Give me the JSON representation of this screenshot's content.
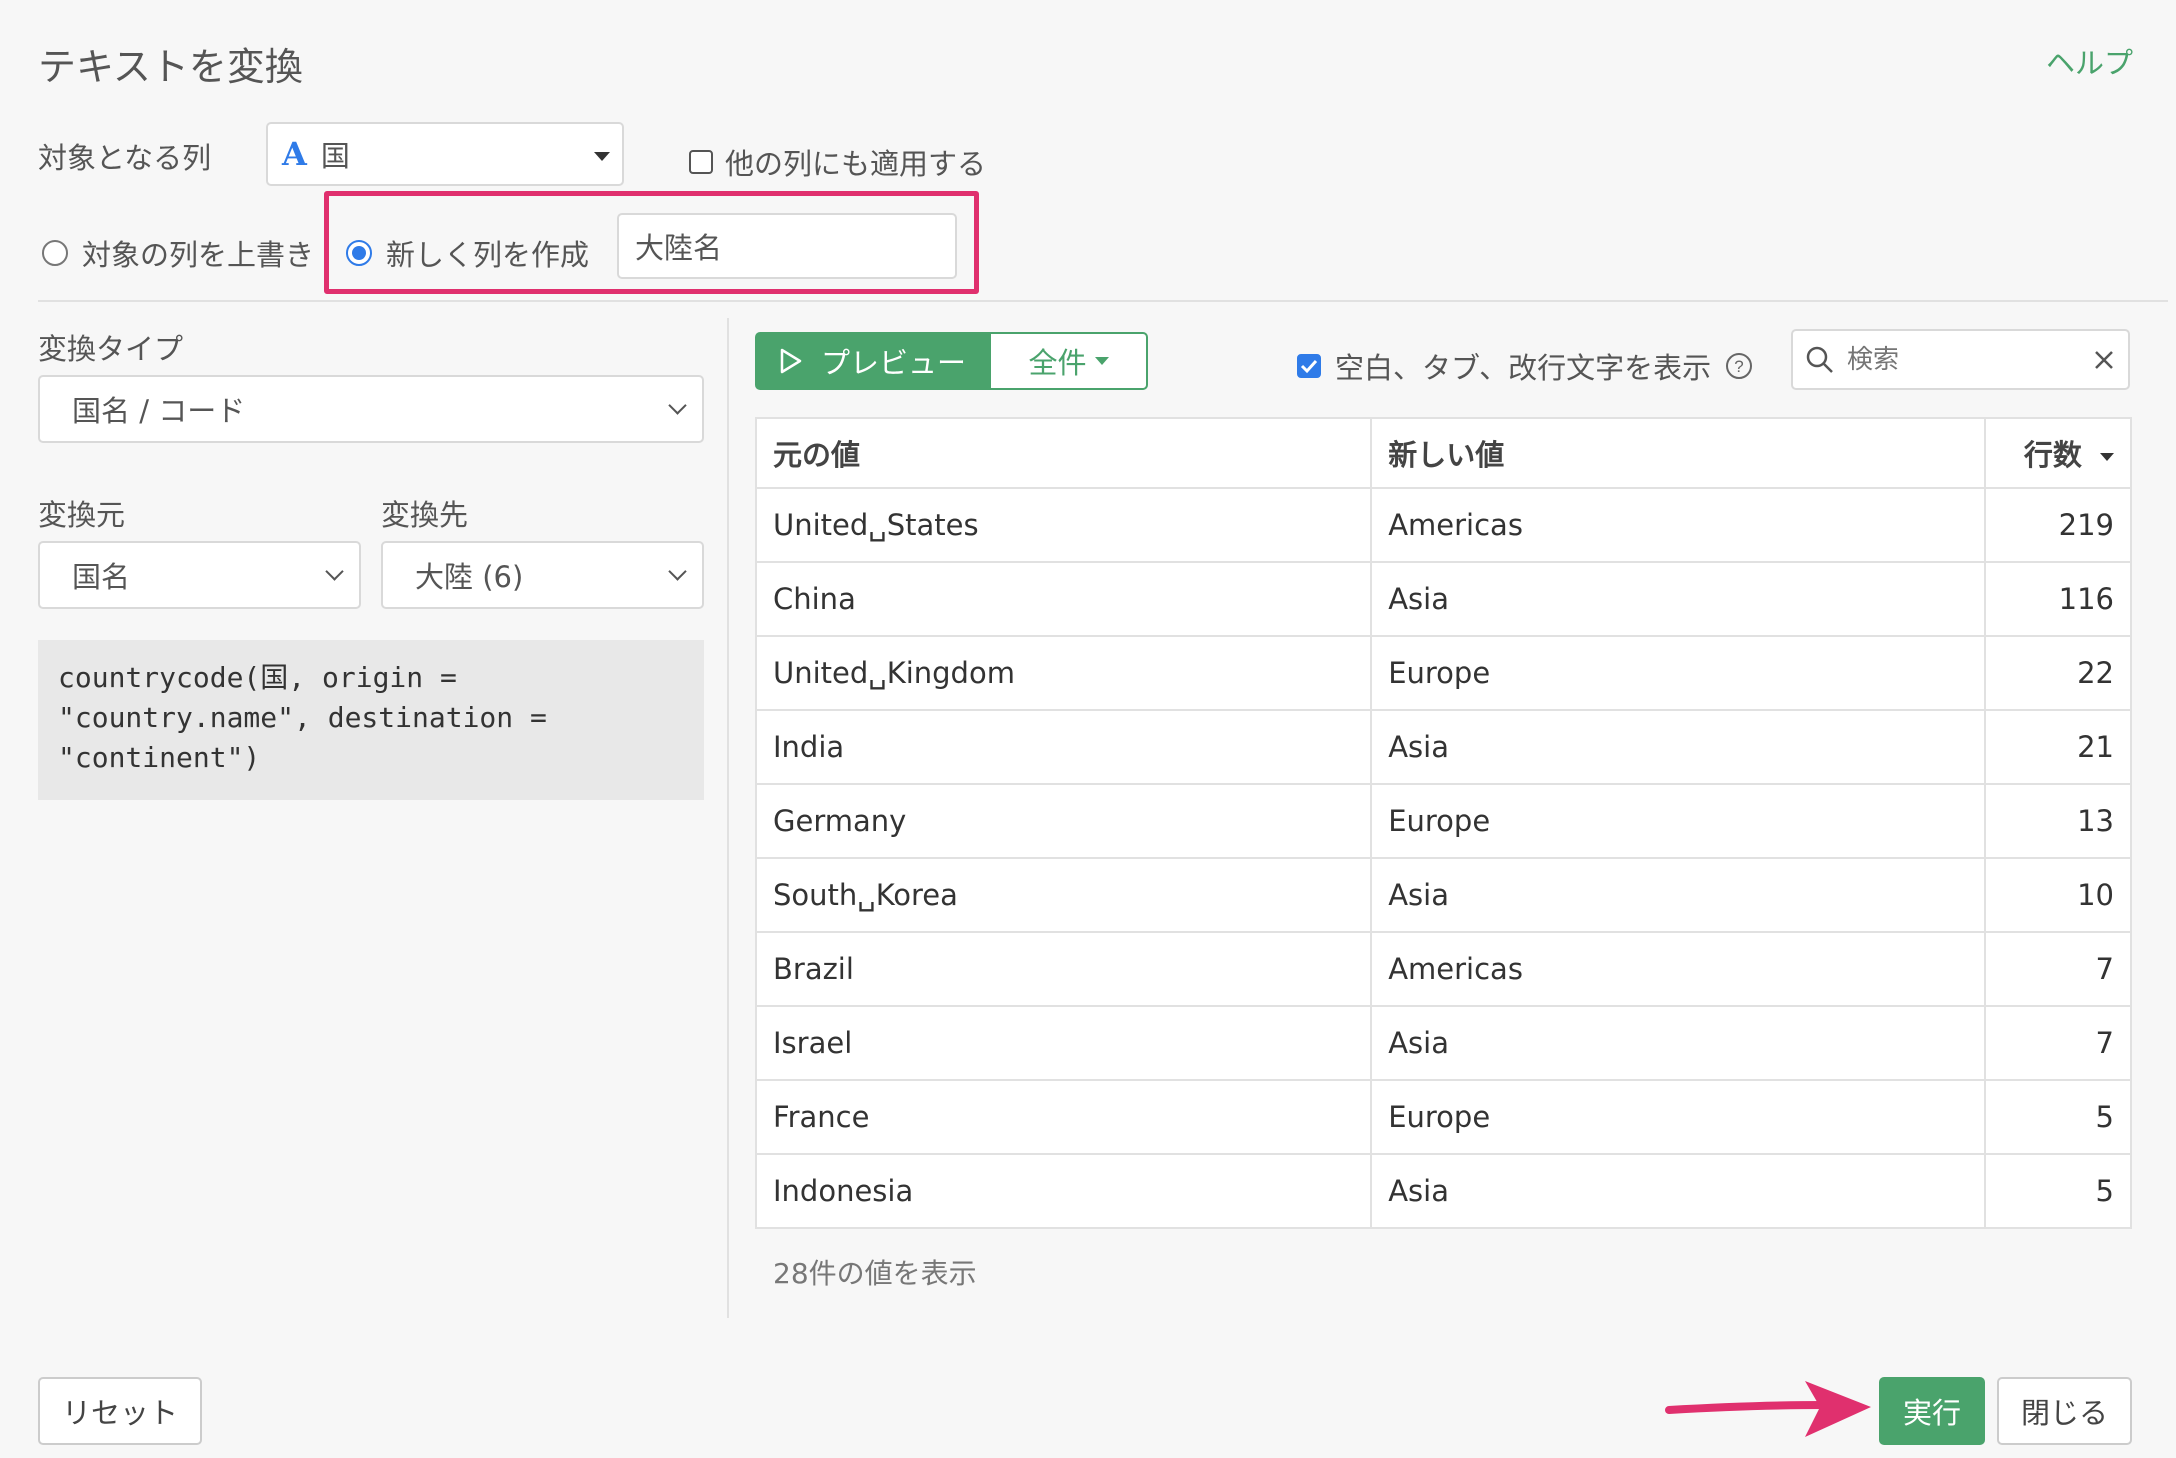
{
  "dialog": {
    "title": "テキストを変換",
    "help_label": "ヘルプ"
  },
  "target": {
    "label": "対象となる列",
    "column_type_icon": "A",
    "column_value": "国",
    "apply_other_label": "他の列にも適用する"
  },
  "output": {
    "overwrite_label": "対象の列を上書き",
    "create_new_label": "新しく列を作成",
    "new_column_name": "大陸名",
    "selected": "create_new"
  },
  "conversion": {
    "type_label": "変換タイプ",
    "type_value": "国名 / コード",
    "from_label": "変換元",
    "from_value": "国名",
    "to_label": "変換先",
    "to_value": "大陸 (6)",
    "code": "countrycode(国, origin =\n\"country.name\", destination =\n\"continent\")"
  },
  "preview": {
    "preview_label": "プレビュー",
    "all_label": "全件",
    "show_whitespace_label": "空白、タブ、改行文字を表示",
    "show_whitespace_checked": true,
    "search_placeholder": "検索",
    "columns": {
      "original": "元の値",
      "new": "新しい値",
      "count": "行数"
    },
    "rows": [
      {
        "original": "United␣States",
        "new": "Americas",
        "count": "219"
      },
      {
        "original": "China",
        "new": "Asia",
        "count": "116"
      },
      {
        "original": "United␣Kingdom",
        "new": "Europe",
        "count": "22"
      },
      {
        "original": "India",
        "new": "Asia",
        "count": "21"
      },
      {
        "original": "Germany",
        "new": "Europe",
        "count": "13"
      },
      {
        "original": "South␣Korea",
        "new": "Asia",
        "count": "10"
      },
      {
        "original": "Brazil",
        "new": "Americas",
        "count": "7"
      },
      {
        "original": "Israel",
        "new": "Asia",
        "count": "7"
      },
      {
        "original": "France",
        "new": "Europe",
        "count": "5"
      },
      {
        "original": "Indonesia",
        "new": "Asia",
        "count": "5"
      }
    ],
    "summary": "28件の値を表示"
  },
  "footer": {
    "reset_label": "リセット",
    "run_label": "実行",
    "close_label": "閉じる"
  },
  "colors": {
    "accent_green": "#4aa36c",
    "highlight_pink": "#e0306e",
    "checkbox_blue": "#2f7be8"
  }
}
